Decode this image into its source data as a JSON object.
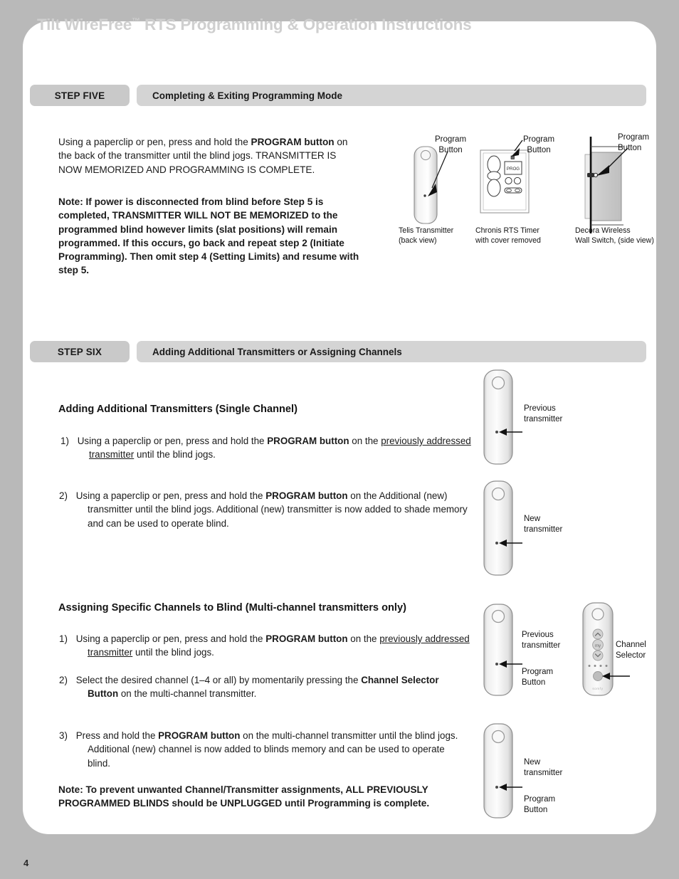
{
  "document": {
    "title": "Tilt WireFree",
    "title_tm": "™",
    "title_rest": " RTS Programming & Operation Instructions",
    "page_number": "4"
  },
  "step_five": {
    "tab_label": "STEP FIVE",
    "title": "Completing & Exiting Programming Mode",
    "paragraph": {
      "p1a": "Using a paperclip or pen, press and hold the ",
      "p1b": "PROGRAM button",
      "p1c": " on the back of the transmitter until the blind jogs. TRANSMITTER IS NOW MEMORIZED AND PROGRAMMING IS COMPLETE."
    },
    "note": "Note:  If power is disconnected from blind before Step 5 is completed, TRANSMITTER WILL NOT BE MEMORIZED to the programmed blind however limits (slat positions) will remain programmed. If this occurs, go back and repeat step 2 (Initiate Programming). Then omit step 4 (Setting Limits) and resume with step 5.",
    "figures": [
      {
        "callout": "Program\nButton",
        "caption": "Telis Transmitter\n(back view)",
        "caption_line1": "Telis Transmitter",
        "caption_line2": "(back view)",
        "callout_line1": "Program",
        "callout_line2": "Button"
      },
      {
        "callout_line1": "Program",
        "callout_line2": "Button",
        "caption_line1": "Chronis RTS Timer",
        "caption_line2": "with cover removed",
        "display_label": "PROG"
      },
      {
        "callout_line1": "Program",
        "callout_line2": "Button",
        "caption_line1": "Decora Wireless",
        "caption_line2": "Wall Switch, (side view)"
      }
    ]
  },
  "step_six": {
    "tab_label": "STEP SIX",
    "title": "Adding Additional Transmitters or Assigning Channels",
    "section_single": {
      "heading": "Adding Additional Transmitters (Single Channel)",
      "items": [
        {
          "num": "1)",
          "a": "Using a paperclip or pen, press and hold the ",
          "b": "PROGRAM button",
          "c": " on the ",
          "u": "previously addressed transmitter",
          "d": " until the blind jogs."
        },
        {
          "num": "2)",
          "a": "Using a paperclip or pen, press and hold the ",
          "b": "PROGRAM button",
          "c": " on the Additional (new) transmitter until the blind jogs. Additional (new) transmitter is now added to shade memory and can be used to operate blind."
        }
      ],
      "figures": [
        {
          "label_line1": "Previous",
          "label_line2": "transmitter"
        },
        {
          "label_line1": "New",
          "label_line2": "transmitter"
        }
      ]
    },
    "section_multi": {
      "heading": "Assigning Specific Channels to Blind (Multi-channel transmitters only)",
      "items": [
        {
          "num": "1)",
          "a": "Using a paperclip or pen, press and hold the ",
          "b": "PROGRAM button",
          "c": " on the ",
          "u": "previously addressed transmitter",
          "d": " until the blind jogs."
        },
        {
          "num": "2)",
          "a": "Select the desired channel (1–4 or all) by momentarily pressing the ",
          "b": "Channel Selector Button",
          "c": " on the multi-channel transmitter."
        },
        {
          "num": "3)",
          "a": "Press and hold the ",
          "b": "PROGRAM button",
          "c": " on the multi-channel transmitter until the blind jogs. Additional (new) channel is now added to blinds memory and can be used to operate blind."
        }
      ],
      "note": "Note:  To prevent unwanted Channel/Transmitter assignments, ALL PREVIOUSLY PROGRAMMED BLINDS should be UNPLUGGED until Programming is complete.",
      "figures": [
        {
          "label_line1": "Previous",
          "label_line2": "transmitter",
          "label2_line1": "Program",
          "label2_line2": "Button"
        },
        {
          "label_line1": "Channel",
          "label_line2": "Selector",
          "brand": "somfy",
          "my_label": "my"
        },
        {
          "label_line1": "New",
          "label_line2": "transmitter",
          "label2_line1": "Program",
          "label2_line2": "Button"
        }
      ]
    }
  },
  "colors": {
    "page_background": "#b9b9b9",
    "panel": "#ffffff",
    "step_tab": "#c9c9c9",
    "step_title_bar": "#d4d4d4",
    "title_text": "#cfcfcf",
    "body_text": "#1b1b1b"
  }
}
